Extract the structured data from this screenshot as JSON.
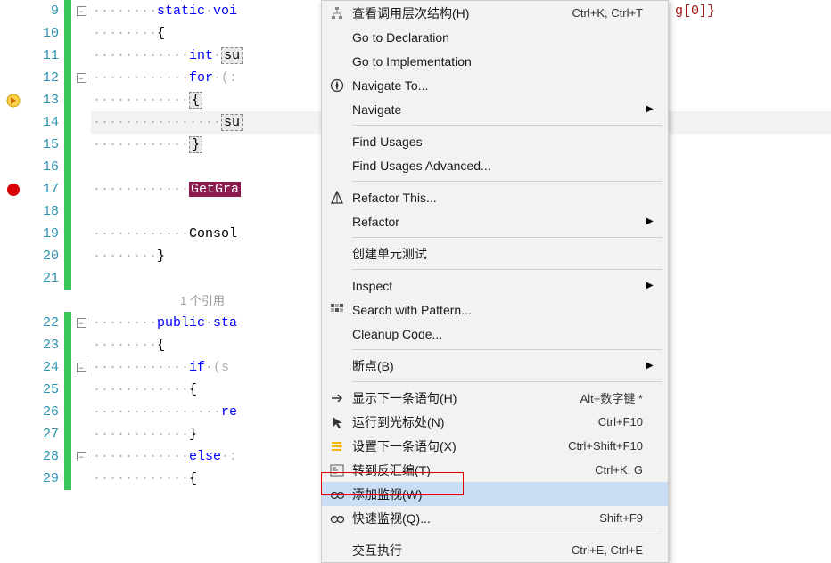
{
  "top_hint": "g[0]}",
  "gutter": {
    "lines": [
      9,
      10,
      11,
      12,
      13,
      14,
      15,
      16,
      17,
      18,
      19,
      20,
      21,
      22,
      23,
      24,
      25,
      26,
      27,
      28,
      29
    ],
    "folds": {
      "9": "-",
      "12": "-",
      "22": "-",
      "24": "-",
      "28": "-"
    },
    "arrow_line": 13,
    "breakpoint_line": 17
  },
  "code": {
    "9": {
      "dots": "········",
      "kw": "static",
      "mid": "·",
      "kw2": "voi"
    },
    "10": {
      "dots": "········",
      "text": "{"
    },
    "11": {
      "dots": "············",
      "kw": "int",
      "mid": "·",
      "sel": "su"
    },
    "12": {
      "dots": "············",
      "kw": "for",
      "mid": "·(:"
    },
    "13": {
      "dots": "············",
      "sel": "{"
    },
    "14": {
      "dots": "················",
      "sel": "su"
    },
    "15": {
      "dots": "············",
      "sel": "}"
    },
    "16": {
      "dots": ""
    },
    "17": {
      "dots": "············",
      "method": "GetGra"
    },
    "18": {
      "dots": ""
    },
    "19": {
      "dots": "············",
      "text": "Consol"
    },
    "20": {
      "dots": "········",
      "text": "}"
    },
    "21": {
      "dots": ""
    },
    "codelens": "1 个引用",
    "22": {
      "dots": "········",
      "kw": "public",
      "mid": "·",
      "kw2": "sta"
    },
    "23": {
      "dots": "········",
      "text": "{"
    },
    "24": {
      "dots": "············",
      "kw": "if",
      "mid": "·(s"
    },
    "25": {
      "dots": "············",
      "text": "{"
    },
    "26": {
      "dots": "················",
      "kw": "re"
    },
    "27": {
      "dots": "············",
      "text": "}"
    },
    "28": {
      "dots": "············",
      "kw": "else",
      "mid": "·:"
    },
    "29": {
      "dots": "············",
      "text": "{"
    }
  },
  "menu": [
    {
      "type": "item",
      "icon": "hierarchy",
      "label": "查看调用层次结构(H)",
      "shortcut": "Ctrl+K, Ctrl+T",
      "disabled": true
    },
    {
      "type": "item",
      "label": "Go to Declaration"
    },
    {
      "type": "item",
      "label": "Go to Implementation"
    },
    {
      "type": "item",
      "icon": "compass",
      "label": "Navigate To...",
      "sub": false
    },
    {
      "type": "item",
      "label": "Navigate",
      "sub": true
    },
    {
      "type": "sep"
    },
    {
      "type": "item",
      "label": "Find Usages"
    },
    {
      "type": "item",
      "label": "Find Usages Advanced..."
    },
    {
      "type": "sep"
    },
    {
      "type": "item",
      "icon": "refactor",
      "label": "Refactor This..."
    },
    {
      "type": "item",
      "label": "Refactor",
      "sub": true
    },
    {
      "type": "sep"
    },
    {
      "type": "item",
      "label": "创建单元测试"
    },
    {
      "type": "sep"
    },
    {
      "type": "item",
      "label": "Inspect",
      "sub": true
    },
    {
      "type": "item",
      "icon": "pattern",
      "label": "Search with Pattern..."
    },
    {
      "type": "item",
      "label": "Cleanup Code..."
    },
    {
      "type": "sep"
    },
    {
      "type": "item",
      "label": "断点(B)",
      "sub": true
    },
    {
      "type": "sep"
    },
    {
      "type": "item",
      "icon": "next-stmt",
      "label": "显示下一条语句(H)",
      "shortcut": "Alt+数字键 *"
    },
    {
      "type": "item",
      "icon": "cursor",
      "label": "运行到光标处(N)",
      "shortcut": "Ctrl+F10"
    },
    {
      "type": "item",
      "icon": "set-stmt",
      "label": "设置下一条语句(X)",
      "shortcut": "Ctrl+Shift+F10"
    },
    {
      "type": "item",
      "icon": "disasm",
      "label": "转到反汇编(T)",
      "shortcut": "Ctrl+K, G"
    },
    {
      "type": "item",
      "icon": "watch",
      "label": "添加监视(W)",
      "hover": true
    },
    {
      "type": "item",
      "icon": "quickwatch",
      "label": "快速监视(Q)...",
      "shortcut": "Shift+F9"
    },
    {
      "type": "sep"
    },
    {
      "type": "item",
      "label": "交互执行",
      "shortcut": "Ctrl+E, Ctrl+E",
      "disabled": true
    }
  ]
}
